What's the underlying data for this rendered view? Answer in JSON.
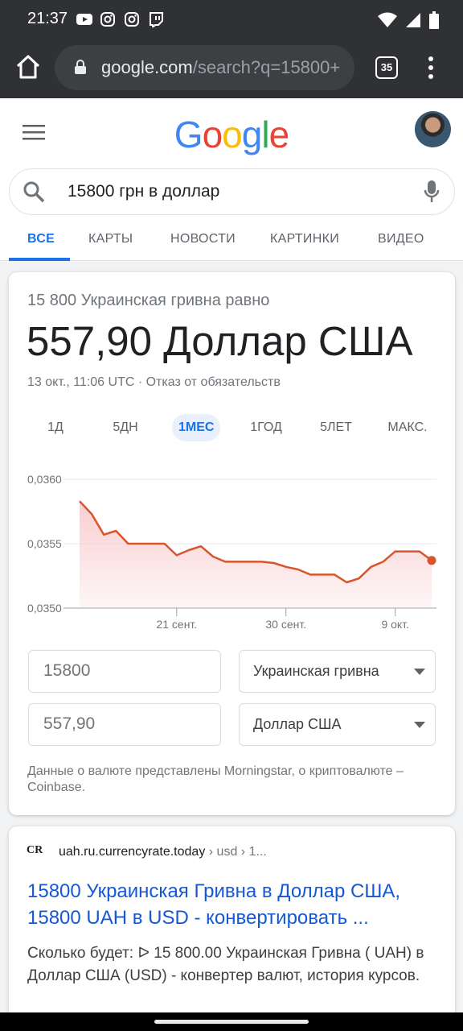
{
  "status_bar": {
    "time": "21:37",
    "app_icons": [
      "youtube-icon",
      "instagram-icon",
      "instagram-icon",
      "twitch-icon"
    ],
    "system_icons": [
      "wifi-icon",
      "signal-icon",
      "battery-icon"
    ]
  },
  "browser": {
    "url_host": "google.com",
    "url_path": "/search?q=15800+",
    "tab_count": "35"
  },
  "google": {
    "logo_letters": [
      {
        "ch": "G",
        "color": "#4285f4"
      },
      {
        "ch": "o",
        "color": "#ea4335"
      },
      {
        "ch": "o",
        "color": "#fbbc05"
      },
      {
        "ch": "g",
        "color": "#4285f4"
      },
      {
        "ch": "l",
        "color": "#34a853"
      },
      {
        "ch": "e",
        "color": "#ea4335"
      }
    ],
    "query": "15800 грн в доллар",
    "tabs": [
      "ВСЕ",
      "КАРТЫ",
      "НОВОСТИ",
      "КАРТИНКИ",
      "ВИДЕО"
    ],
    "active_tab": "ВСЕ"
  },
  "converter": {
    "equals_label": "15 800 Украинская гривна равно",
    "result": "557,90 Доллар США",
    "timestamp": "13 окт., 11:06 UTC · Отказ от обязательств",
    "ranges": [
      "1Д",
      "5ДН",
      "1МЕС",
      "1ГОД",
      "5ЛЕТ",
      "МАКС."
    ],
    "active_range": "1МЕС",
    "amount_from": "15800",
    "currency_from": "Украинская гривна",
    "amount_to": "557,90",
    "currency_to": "Доллар США",
    "source_note": "Данные о валюте представлены Morningstar, о криптовалюте – Coinbase."
  },
  "chart_data": {
    "type": "area",
    "y_ticks": [
      "0,0360",
      "0,0355",
      "0,0350"
    ],
    "ylim": [
      0.035,
      0.036
    ],
    "x_ticks": [
      {
        "label": "21 сент.",
        "x": 8
      },
      {
        "label": "30 сент.",
        "x": 17
      },
      {
        "label": "9 окт.",
        "x": 26
      }
    ],
    "x": [
      0,
      1,
      2,
      3,
      4,
      5,
      6,
      7,
      8,
      9,
      10,
      11,
      12,
      13,
      14,
      15,
      16,
      17,
      18,
      19,
      20,
      21,
      22,
      23,
      24,
      25,
      26,
      27,
      28,
      29
    ],
    "values": [
      0.03583,
      0.03573,
      0.03557,
      0.0356,
      0.0355,
      0.0355,
      0.0355,
      0.0355,
      0.03541,
      0.03545,
      0.03548,
      0.0354,
      0.03536,
      0.03536,
      0.03536,
      0.03536,
      0.03535,
      0.03532,
      0.0353,
      0.03526,
      0.03526,
      0.03526,
      0.0352,
      0.03523,
      0.03532,
      0.03536,
      0.03544,
      0.03544,
      0.03544,
      0.03537
    ],
    "line_color": "#d9542b",
    "fill_color": "#f7c5c8",
    "grid": true
  },
  "result_card": {
    "favicon_text": "CR",
    "site": "uah.ru.currencyrate.today",
    "breadcrumb": " › usd › 1...",
    "title": "15800 Украинская Гривна в Доллар США, 15800 UAH в USD - конвертировать ...",
    "snippet": "Сколько будет: ᐅ 15 800.00 Украинская Гривна ( UAH) в Доллар США (USD) - конвертер валют, история курсов."
  }
}
